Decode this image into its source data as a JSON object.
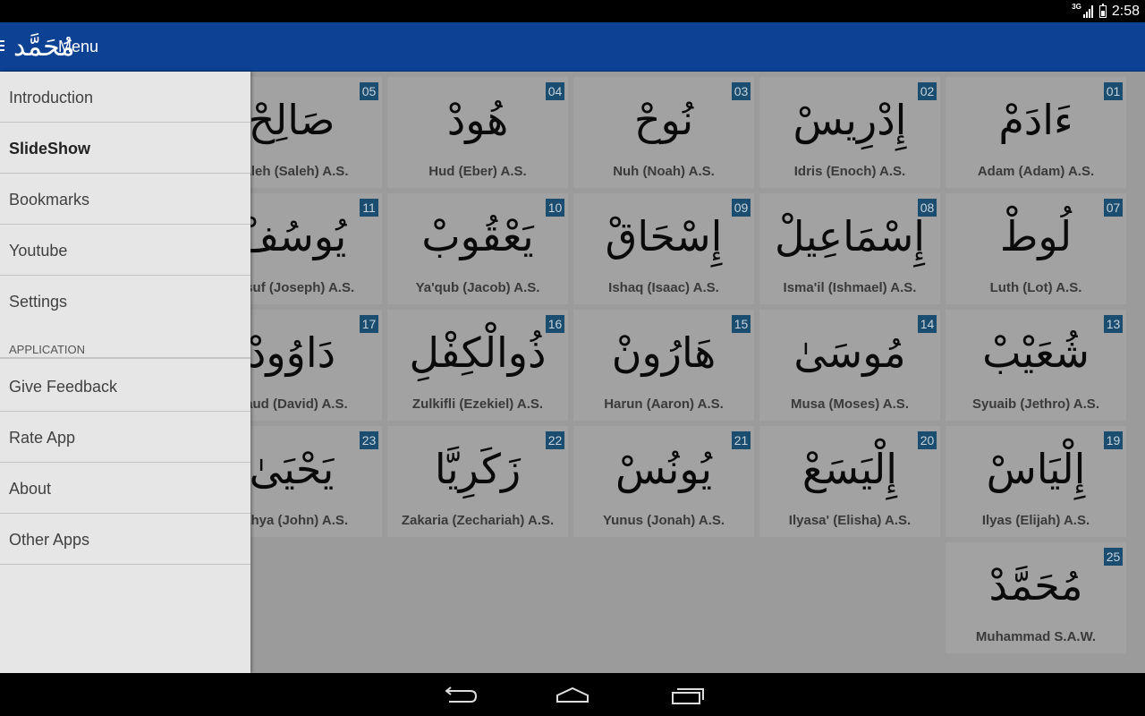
{
  "status_bar": {
    "network": "3G",
    "time": "2:58"
  },
  "app_bar": {
    "logo_glyph": "مُحَمَّد",
    "title": "Menu"
  },
  "drawer": {
    "items": [
      {
        "label": "Introduction",
        "bold": false
      },
      {
        "label": "SlideShow",
        "bold": true
      },
      {
        "label": "Bookmarks",
        "bold": false
      },
      {
        "label": "Youtube",
        "bold": false
      },
      {
        "label": "Settings",
        "bold": false
      }
    ],
    "section_header": "APPLICATION",
    "app_items": [
      {
        "label": "Give Feedback"
      },
      {
        "label": "Rate App"
      },
      {
        "label": "About"
      },
      {
        "label": "Other Apps"
      }
    ]
  },
  "prophets": [
    {
      "number": "01",
      "arabic": "ءَادَمْ",
      "latin": "Adam (Adam) A.S."
    },
    {
      "number": "02",
      "arabic": "إِدْرِيسْ",
      "latin": "Idris (Enoch) A.S."
    },
    {
      "number": "03",
      "arabic": "نُوحْ",
      "latin": "Nuh (Noah) A.S."
    },
    {
      "number": "04",
      "arabic": "هُودْ",
      "latin": "Hud (Eber) A.S."
    },
    {
      "number": "05",
      "arabic": "صَالِحْ",
      "latin": "Saleh (Saleh) A.S."
    },
    {
      "number": "07",
      "arabic": "لُوطْ",
      "latin": "Luth (Lot) A.S."
    },
    {
      "number": "08",
      "arabic": "إِسْمَاعِيلْ",
      "latin": "Isma'il (Ishmael) A.S."
    },
    {
      "number": "09",
      "arabic": "إِسْحَاقْ",
      "latin": "Ishaq (Isaac) A.S."
    },
    {
      "number": "10",
      "arabic": "يَعْقُوبْ",
      "latin": "Ya'qub (Jacob) A.S."
    },
    {
      "number": "11",
      "arabic": "يُوسُفْ",
      "latin": "Yusuf (Joseph) A.S."
    },
    {
      "number": "13",
      "arabic": "شُعَيْبْ",
      "latin": "Syuaib (Jethro) A.S."
    },
    {
      "number": "14",
      "arabic": "مُوسَىٰ",
      "latin": "Musa (Moses) A.S."
    },
    {
      "number": "15",
      "arabic": "هَارُونْ",
      "latin": "Harun (Aaron) A.S."
    },
    {
      "number": "16",
      "arabic": "ذُوالْكِفْلِ",
      "latin": "Zulkifli (Ezekiel) A.S."
    },
    {
      "number": "17",
      "arabic": "دَاوُودْ",
      "latin": "Daud (David) A.S."
    },
    {
      "number": "19",
      "arabic": "إِلْيَاسْ",
      "latin": "Ilyas (Elijah) A.S."
    },
    {
      "number": "20",
      "arabic": "إِلْيَسَعْ",
      "latin": "Ilyasa' (Elisha) A.S."
    },
    {
      "number": "21",
      "arabic": "يُونُسْ",
      "latin": "Yunus (Jonah) A.S."
    },
    {
      "number": "22",
      "arabic": "زَكَرِيَّا",
      "latin": "Zakaria (Zechariah) A.S."
    },
    {
      "number": "23",
      "arabic": "يَحْيَىٰ",
      "latin": "Yahya (John) A.S."
    },
    {
      "number": "25",
      "arabic": "مُحَمَّدْ",
      "latin": "Muhammad S.A.W."
    }
  ]
}
